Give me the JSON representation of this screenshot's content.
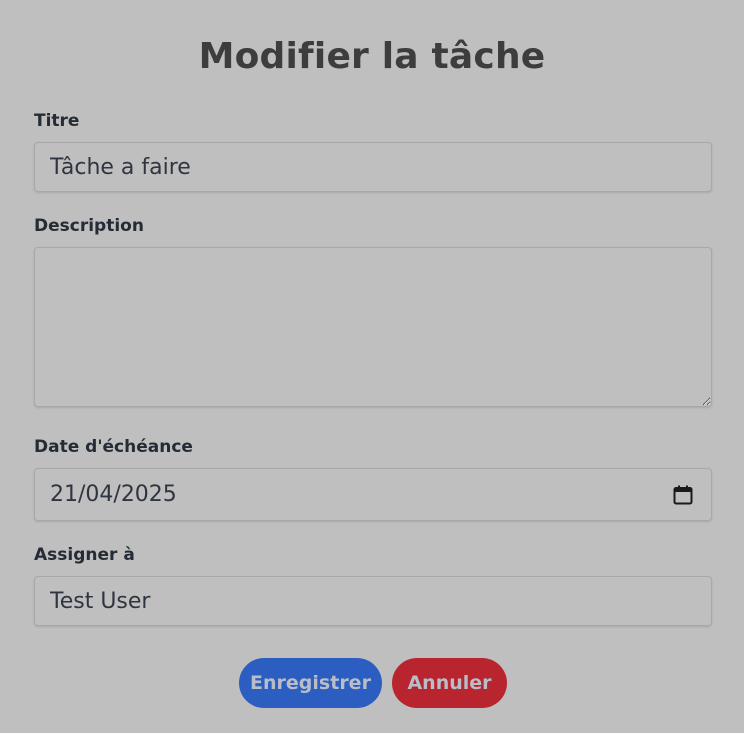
{
  "modal": {
    "title": "Modifier la tâche"
  },
  "form": {
    "title_label": "Titre",
    "title_value": "Tâche a faire",
    "description_label": "Description",
    "description_value": "",
    "due_date_label": "Date d'échéance",
    "due_date_value": "21/04/2025",
    "assignee_label": "Assigner à",
    "assignee_value": "Test User"
  },
  "buttons": {
    "save_label": "Enregistrer",
    "cancel_label": "Annuler"
  },
  "icons": {
    "calendar": "calendar-icon"
  },
  "colors": {
    "save": "#2b5ec0",
    "cancel": "#b8252e",
    "background": "#bfbfbf"
  }
}
